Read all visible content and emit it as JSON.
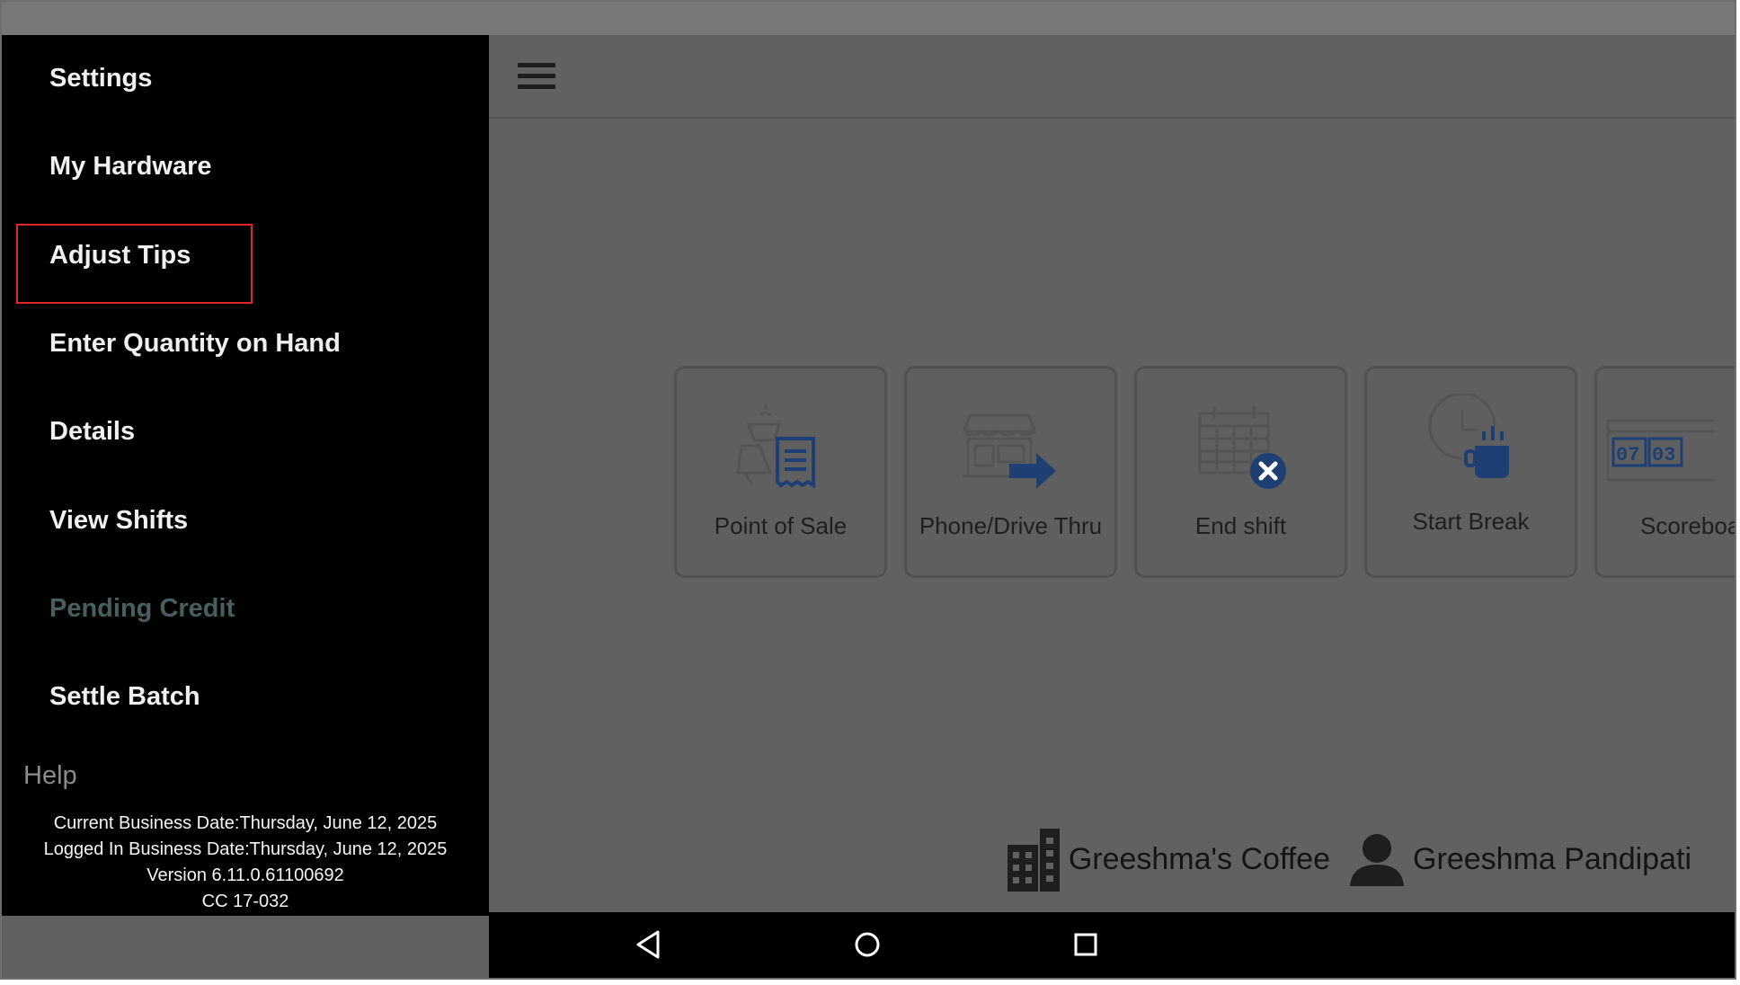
{
  "drawer": {
    "items": [
      {
        "label": "Settings",
        "enabled": true
      },
      {
        "label": "My Hardware",
        "enabled": true
      },
      {
        "label": "Adjust Tips",
        "enabled": true,
        "highlighted": true
      },
      {
        "label": "Enter Quantity on Hand",
        "enabled": true
      },
      {
        "label": "Details",
        "enabled": true
      },
      {
        "label": "View Shifts",
        "enabled": true
      },
      {
        "label": "Pending Credit",
        "enabled": false
      },
      {
        "label": "Settle Batch",
        "enabled": true
      }
    ],
    "help_label": "Help",
    "info": {
      "current_business_date": "Current Business Date:Thursday, June 12, 2025",
      "logged_in_business_date": "Logged In Business Date:Thursday, June 12, 2025",
      "version": "Version 6.11.0.61100692",
      "cc": "CC 17-032"
    }
  },
  "tiles": [
    {
      "label": "Point of Sale",
      "icon": "point-of-sale-icon"
    },
    {
      "label": "Phone/Drive Thru",
      "icon": "phone-drive-thru-icon"
    },
    {
      "label": "End shift",
      "icon": "end-shift-icon"
    },
    {
      "label": "Start Break",
      "icon": "start-break-icon"
    },
    {
      "label": "Scoreboa",
      "icon": "scoreboard-icon"
    }
  ],
  "footer": {
    "store_name": "Greeshma's Coffee",
    "user_name": "Greeshma Pandipati"
  },
  "colors": {
    "drawer_bg": "#000000",
    "highlight_border": "#e0242a",
    "icon_blue": "#1d3f73",
    "disabled_text": "#47605f"
  }
}
